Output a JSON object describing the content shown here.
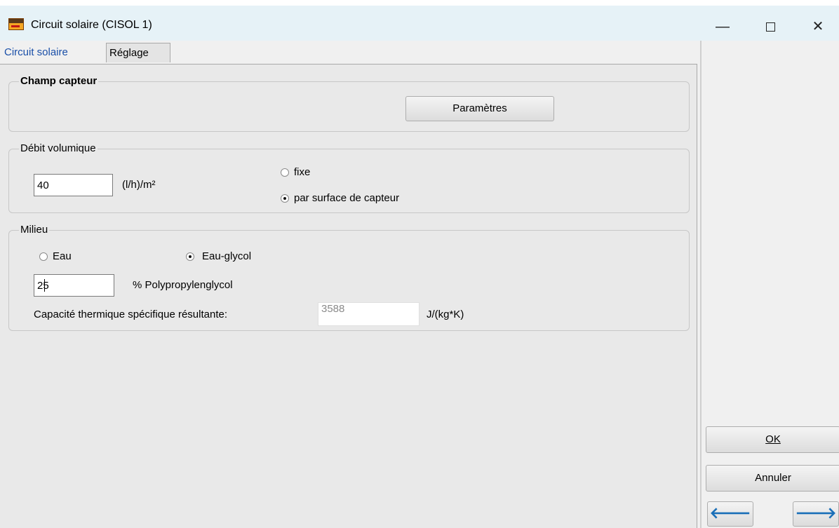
{
  "window": {
    "title": "Circuit solaire  (CISOL 1)",
    "minimize_glyph": "—",
    "close_glyph": "✕"
  },
  "tabs": [
    {
      "label": "Circuit solaire",
      "active": true
    },
    {
      "label": "Réglage",
      "active": false
    }
  ],
  "champ_capteur": {
    "legend": "Champ capteur",
    "parametres_button": "Paramètres"
  },
  "debit": {
    "legend": "Débit volumique",
    "value": "40",
    "unit": "(l/h)/m²",
    "options": [
      {
        "label": "fixe",
        "checked": false
      },
      {
        "label": "par surface de capteur",
        "checked": true
      }
    ]
  },
  "milieu": {
    "legend": "Milieu",
    "options": [
      {
        "label": "Eau",
        "checked": false
      },
      {
        "label": "Eau-glycol",
        "checked": true
      }
    ],
    "glycol_value": "25",
    "glycol_label": "%  Polypropylenglycol",
    "capacite_label": "Capacité thermique spécifique résultante:",
    "capacite_value": "3588",
    "capacite_unit": "J/(kg*K)"
  },
  "actions": {
    "ok_label": "OK",
    "annuler_label": "Annuler",
    "prev_glyph": "🡐",
    "next_glyph": "🡒"
  },
  "icons": {
    "app": "app-icon",
    "prev": "arrow-left-icon",
    "next": "arrow-right-icon"
  }
}
